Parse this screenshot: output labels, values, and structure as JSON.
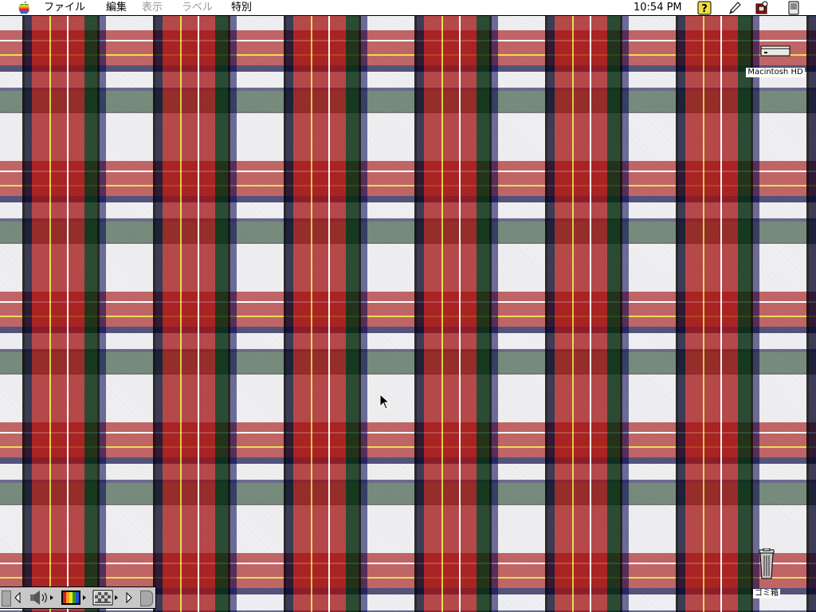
{
  "menubar": {
    "apple_icon": "apple-logo-icon",
    "items": [
      {
        "label": "ファイル",
        "enabled": true
      },
      {
        "label": "編集",
        "enabled": true
      },
      {
        "label": "表示",
        "enabled": false
      },
      {
        "label": "ラベル",
        "enabled": false
      },
      {
        "label": "特別",
        "enabled": true
      }
    ],
    "clock": "10:54 PM",
    "tray_icons": [
      "help-icon",
      "pencil-icon",
      "app-switcher-icon",
      "device-icon"
    ]
  },
  "desktop": {
    "pattern": "red-black-white-tartan",
    "icons": [
      {
        "label": "Macintosh HD",
        "icon": "hard-disk-icon"
      },
      {
        "label": "ゴミ箱",
        "icon": "trash-can-icon"
      }
    ]
  },
  "control_strip": {
    "items": [
      "sound-volume-icon",
      "monitor-color-icon",
      "desktop-pattern-icon"
    ]
  },
  "colors": {
    "tartan_red": "#a00a0a",
    "tartan_dark": "#00280a",
    "tartan_navy": "#000050",
    "tartan_yellow": "#e6dc3c",
    "menubar_bg": "#ffffff"
  }
}
